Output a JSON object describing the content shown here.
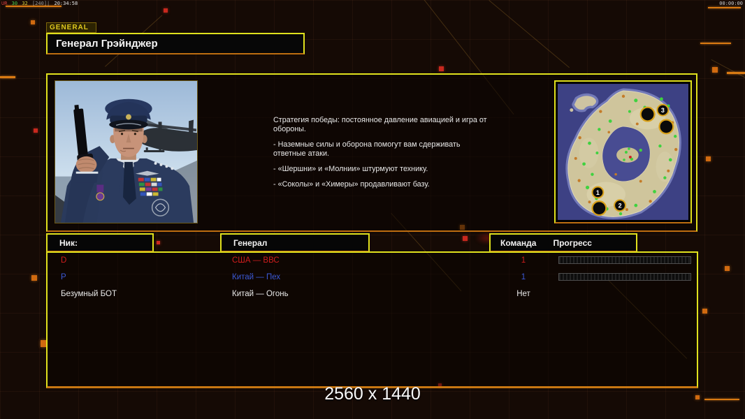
{
  "overlay": {
    "perf_left": [
      "UR",
      "30",
      "32",
      "[240]|",
      "20:34:58"
    ],
    "timer": "00:00:00",
    "watermark": "2560 x 1440"
  },
  "header": {
    "tab": "GENERAL",
    "title": "Генерал Грэйнджер"
  },
  "briefing": {
    "paragraphs": [
      "Стратегия победы: постоянное давление авиацией и игра от обороны.",
      "- Наземные силы и оборона помогут вам сдерживать ответные атаки.",
      "- «Шершни» и «Молнии» штурмуют технику.",
      "- «Соколы» и «Химеры» продавливают базу."
    ]
  },
  "map_preview": {
    "start_positions": [
      "1",
      "2",
      "3"
    ]
  },
  "players": {
    "headers": {
      "nick": "Ник:",
      "general": "Генерал",
      "team": "Команда",
      "progress": "Прогресс"
    },
    "rows": [
      {
        "nick": "D",
        "general": "США — ВВС",
        "team": "1",
        "progress_bar": true,
        "color": "#cf1d1d"
      },
      {
        "nick": "P",
        "general": "Китай — Пех",
        "team": "1",
        "progress_bar": true,
        "color": "#3b59d6"
      },
      {
        "nick": "Безумный БОТ",
        "general": "Китай — Огонь",
        "team": "Нет",
        "progress_bar": false,
        "color": "#e9e9e9"
      }
    ]
  },
  "colors": {
    "background": "#150a05",
    "accent_yellow": "#e0e11d",
    "accent_orange": "#c87712",
    "red_player": "#cf1d1d",
    "blue_player": "#3b59d6",
    "white_text": "#f2f2f2"
  }
}
